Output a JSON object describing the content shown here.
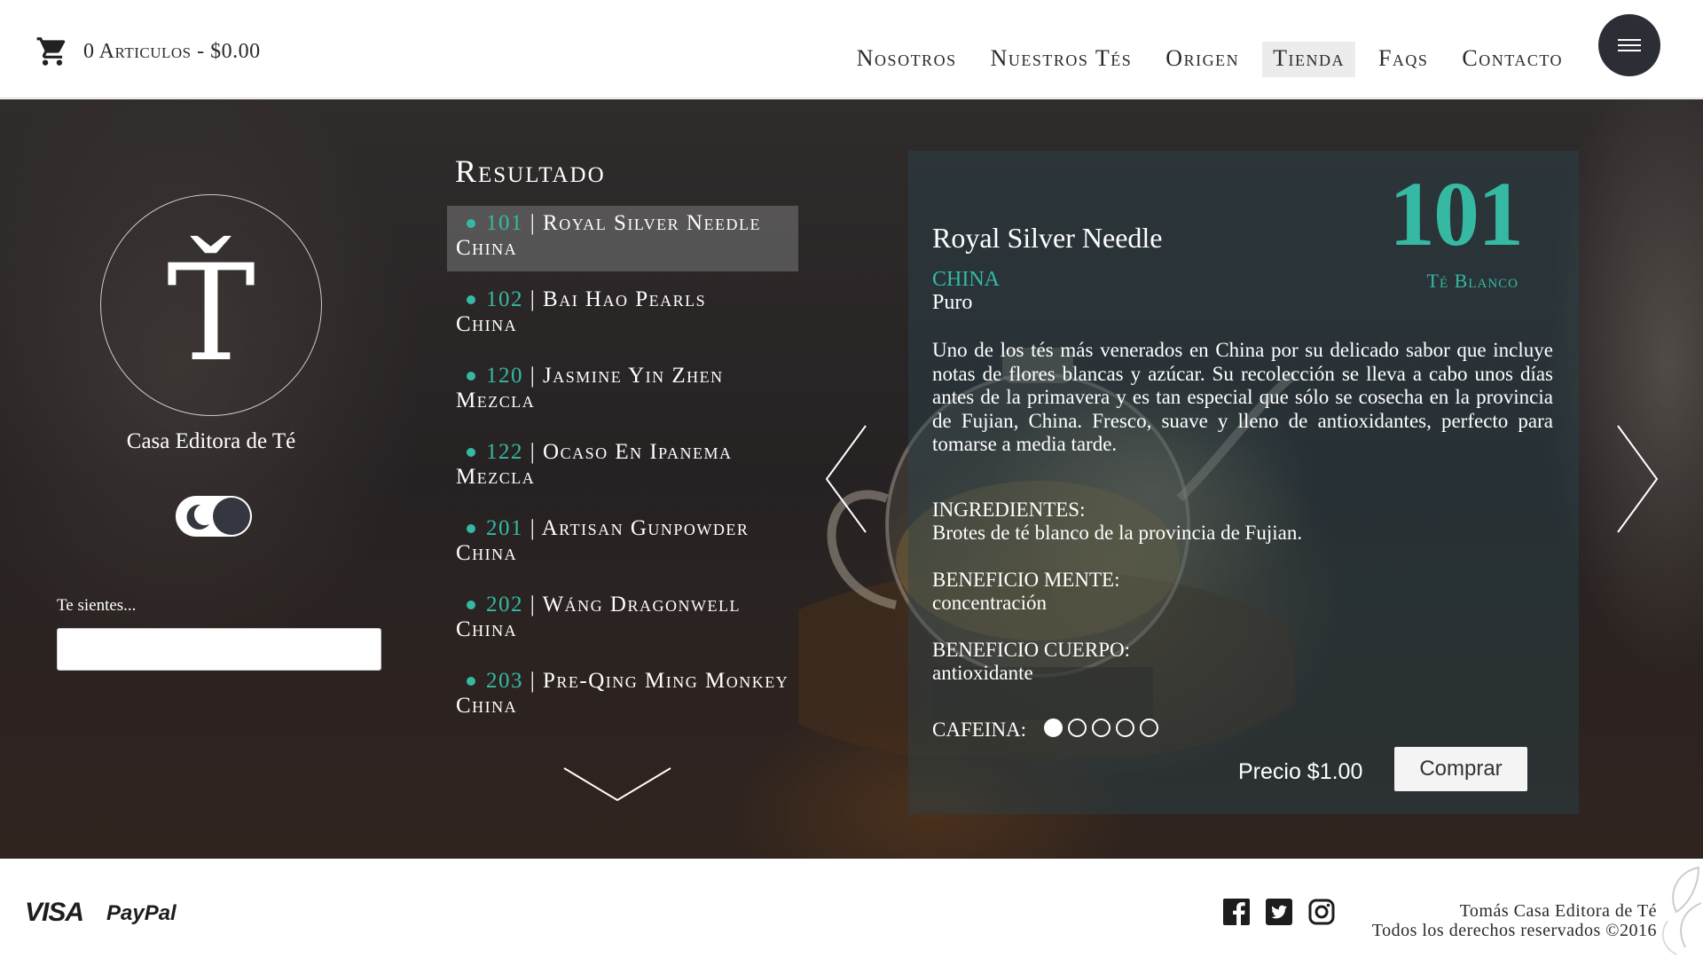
{
  "header": {
    "cart_label": "0 Articulos - $0.00",
    "nav": [
      {
        "label": "Nosotros",
        "active": false
      },
      {
        "label": "Nuestros Tés",
        "active": false
      },
      {
        "label": "Origen",
        "active": false
      },
      {
        "label": "Tienda",
        "active": true
      },
      {
        "label": "Faqs",
        "active": false
      },
      {
        "label": "Contacto",
        "active": false
      }
    ],
    "icons": {
      "cart": "cart-icon",
      "menu": "hamburger-menu-icon"
    }
  },
  "sidebar": {
    "logo_letter": "Ť",
    "brand_name": "Casa Editora de Té",
    "theme_toggle_icon": "moon-icon",
    "feel_label": "Te sientes...",
    "feel_value": ""
  },
  "results": {
    "title": "Resultado",
    "items": [
      {
        "code": "101",
        "name": "Royal Silver Needle",
        "origin": "China",
        "selected": true
      },
      {
        "code": "102",
        "name": "Bai Hao Pearls",
        "origin": "China",
        "selected": false
      },
      {
        "code": "120",
        "name": "Jasmine Yin Zhen",
        "origin": "Mezcla",
        "selected": false
      },
      {
        "code": "122",
        "name": "Ocaso En Ipanema",
        "origin": "Mezcla",
        "selected": false
      },
      {
        "code": "201",
        "name": "Artisan Gunpowder",
        "origin": "China",
        "selected": false
      },
      {
        "code": "202",
        "name": "Wáng Dragonwell",
        "origin": "China",
        "selected": false
      },
      {
        "code": "203",
        "name": "Pre-Qing Ming Monkey",
        "origin": "China",
        "selected": false
      }
    ],
    "scroll_icon": "chevron-down-icon"
  },
  "detail": {
    "name": "Royal Silver Needle",
    "number": "101",
    "type": "Té Blanco",
    "origin": "CHINA",
    "blend": "Puro",
    "description": "Uno de los tés más venerados en China por su delicado sabor que incluye notas de flores blancas y azúcar. Su recolección se lleva a cabo unos días antes de la primavera y es tan especial que sólo se cosecha en la provincia de Fujian, China. Fresco, suave y lleno de antioxidantes, perfecto para tomarse a media tarde.",
    "ingredients_label": "INGREDIENTES:",
    "ingredients": "Brotes de té blanco de la provincia de Fujian.",
    "mind_label": "BENEFICIO MENTE:",
    "mind": "concentración",
    "body_label": "BENEFICIO CUERPO:",
    "body": "antioxidante",
    "caffeine_label": "CAFEINA:",
    "caffeine_level": 1,
    "caffeine_max": 5,
    "price": "Precio $1.00",
    "buy_label": "Comprar",
    "accent_color": "#35b9a3"
  },
  "footer": {
    "visa": "VISA",
    "paypal": "PayPal",
    "social_icons": [
      "facebook-icon",
      "twitter-icon",
      "instagram-icon"
    ],
    "copyright_line1": "Tomás Casa Editora de Té",
    "copyright_line2": "Todos los derechos reservados ©2016"
  }
}
